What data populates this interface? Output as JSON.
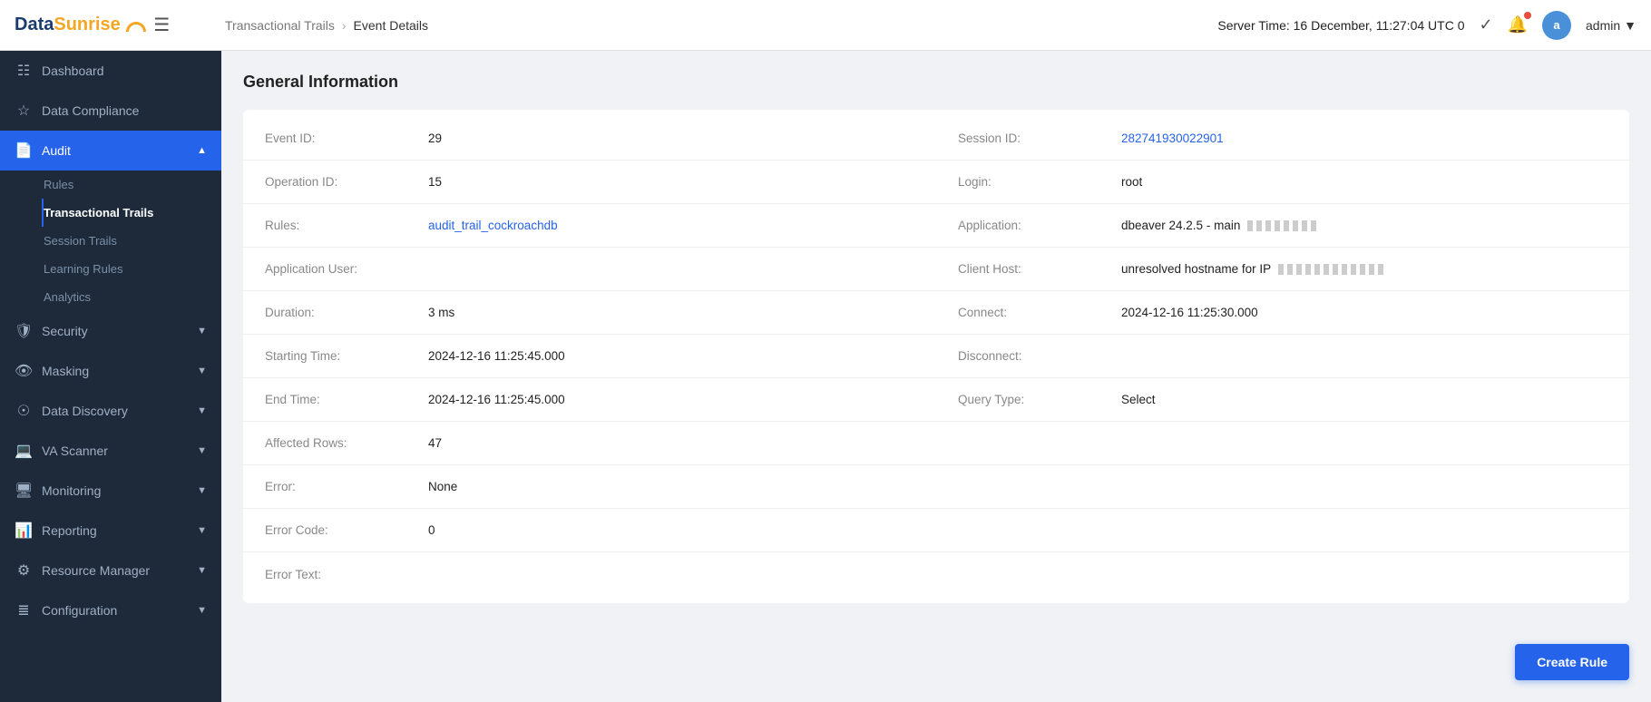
{
  "logo": {
    "data": "Data",
    "sunrise": "Sunrise"
  },
  "header": {
    "breadcrumb_parent": "Transactional Trails",
    "breadcrumb_sep": "›",
    "breadcrumb_current": "Event Details",
    "server_time_label": "Server Time:",
    "server_time_value": "16 December, 11:27:04  UTC 0",
    "user": "admin"
  },
  "sidebar": {
    "items": [
      {
        "id": "dashboard",
        "label": "Dashboard",
        "icon": "⊞",
        "active": false
      },
      {
        "id": "data-compliance",
        "label": "Data Compliance",
        "icon": "☆",
        "active": false
      },
      {
        "id": "audit",
        "label": "Audit",
        "icon": "📄",
        "active": true,
        "expanded": true
      }
    ],
    "audit_sub": [
      {
        "id": "rules",
        "label": "Rules",
        "active": false
      },
      {
        "id": "transactional-trails",
        "label": "Transactional Trails",
        "active": true
      },
      {
        "id": "session-trails",
        "label": "Session Trails",
        "active": false
      },
      {
        "id": "learning-rules",
        "label": "Learning Rules",
        "active": false
      },
      {
        "id": "analytics",
        "label": "Analytics",
        "active": false
      }
    ],
    "other_items": [
      {
        "id": "security",
        "label": "Security",
        "icon": "🛡",
        "active": false
      },
      {
        "id": "masking",
        "label": "Masking",
        "icon": "👁",
        "active": false
      },
      {
        "id": "data-discovery",
        "label": "Data Discovery",
        "icon": "⊙",
        "active": false
      },
      {
        "id": "va-scanner",
        "label": "VA Scanner",
        "icon": "💻",
        "active": false
      },
      {
        "id": "monitoring",
        "label": "Monitoring",
        "icon": "🖥",
        "active": false
      },
      {
        "id": "reporting",
        "label": "Reporting",
        "icon": "📊",
        "active": false
      },
      {
        "id": "resource-manager",
        "label": "Resource Manager",
        "icon": "⚙",
        "active": false
      },
      {
        "id": "configuration",
        "label": "Configuration",
        "icon": "≋",
        "active": false
      }
    ]
  },
  "main": {
    "section_title": "General Information",
    "fields": [
      {
        "left_label": "Event ID:",
        "left_value": "29",
        "left_type": "text",
        "right_label": "Session ID:",
        "right_value": "282741930022901",
        "right_type": "link"
      },
      {
        "left_label": "Operation ID:",
        "left_value": "15",
        "left_type": "text",
        "right_label": "Login:",
        "right_value": "root",
        "right_type": "text"
      },
      {
        "left_label": "Rules:",
        "left_value": "audit_trail_cockroachdb",
        "left_type": "link",
        "right_label": "Application:",
        "right_value": "dbeaver 24.2.5 - main",
        "right_type": "text-blurred"
      },
      {
        "left_label": "Application User:",
        "left_value": "",
        "left_type": "text",
        "right_label": "Client Host:",
        "right_value": "unresolved hostname for IP",
        "right_type": "text-blurred"
      },
      {
        "left_label": "Duration:",
        "left_value": "3 ms",
        "left_type": "text",
        "right_label": "Connect:",
        "right_value": "2024-12-16 11:25:30.000",
        "right_type": "text"
      },
      {
        "left_label": "Starting Time:",
        "left_value": "2024-12-16 11:25:45.000",
        "left_type": "text",
        "right_label": "Disconnect:",
        "right_value": "",
        "right_type": "text"
      },
      {
        "left_label": "End Time:",
        "left_value": "2024-12-16 11:25:45.000",
        "left_type": "text",
        "right_label": "Query Type:",
        "right_value": "Select",
        "right_type": "text"
      },
      {
        "left_label": "Affected Rows:",
        "left_value": "47",
        "left_type": "text",
        "right_label": "",
        "right_value": "",
        "right_type": "text"
      },
      {
        "left_label": "Error:",
        "left_value": "None",
        "left_type": "text",
        "right_label": "",
        "right_value": "",
        "right_type": "text"
      },
      {
        "left_label": "Error Code:",
        "left_value": "0",
        "left_type": "text",
        "right_label": "",
        "right_value": "",
        "right_type": "text"
      },
      {
        "left_label": "Error Text:",
        "left_value": "",
        "left_type": "text",
        "right_label": "",
        "right_value": "",
        "right_type": "text"
      }
    ],
    "create_rule_label": "Create Rule"
  }
}
